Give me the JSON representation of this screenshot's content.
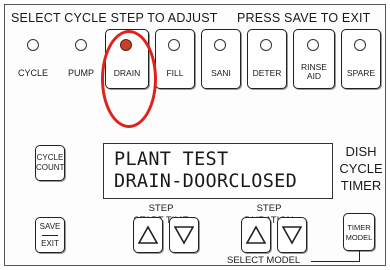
{
  "header": {
    "select_cycle_step": "SELECT CYCLE STEP TO ADJUST",
    "press_save": "PRESS SAVE TO EXIT"
  },
  "step_selectors": [
    {
      "label": "CYCLE",
      "led": "off"
    },
    {
      "label": "PUMP",
      "led": "off"
    },
    {
      "label": "DRAIN",
      "led": "on"
    },
    {
      "label": "FILL",
      "led": "off"
    },
    {
      "label": "SANI",
      "led": "off"
    },
    {
      "label": "DETER",
      "led": "off"
    },
    {
      "label_line1": "RINSE",
      "label_line2": "AID",
      "led": "off"
    },
    {
      "label": "SPARE",
      "led": "off"
    }
  ],
  "cycle_count": {
    "line1": "CYCLE",
    "line2": "COUNT"
  },
  "display": {
    "line1": "PLANT TEST",
    "line2": "DRAIN-DOORCLOSED"
  },
  "device_name": {
    "line1": "DISH",
    "line2": "CYCLE",
    "line3": "TIMER"
  },
  "step_start_time": {
    "line1": "STEP",
    "line2": "START TIME"
  },
  "step_duration": {
    "line1": "STEP",
    "line2": "DURATION"
  },
  "save_exit": {
    "save": "SAVE",
    "exit": "EXIT"
  },
  "timer_model": {
    "line1": "TIMER",
    "line2": "MODEL"
  },
  "select_model": "SELECT MODEL",
  "colors": {
    "led_on": "#c8402c",
    "highlight": "#e0221b"
  }
}
